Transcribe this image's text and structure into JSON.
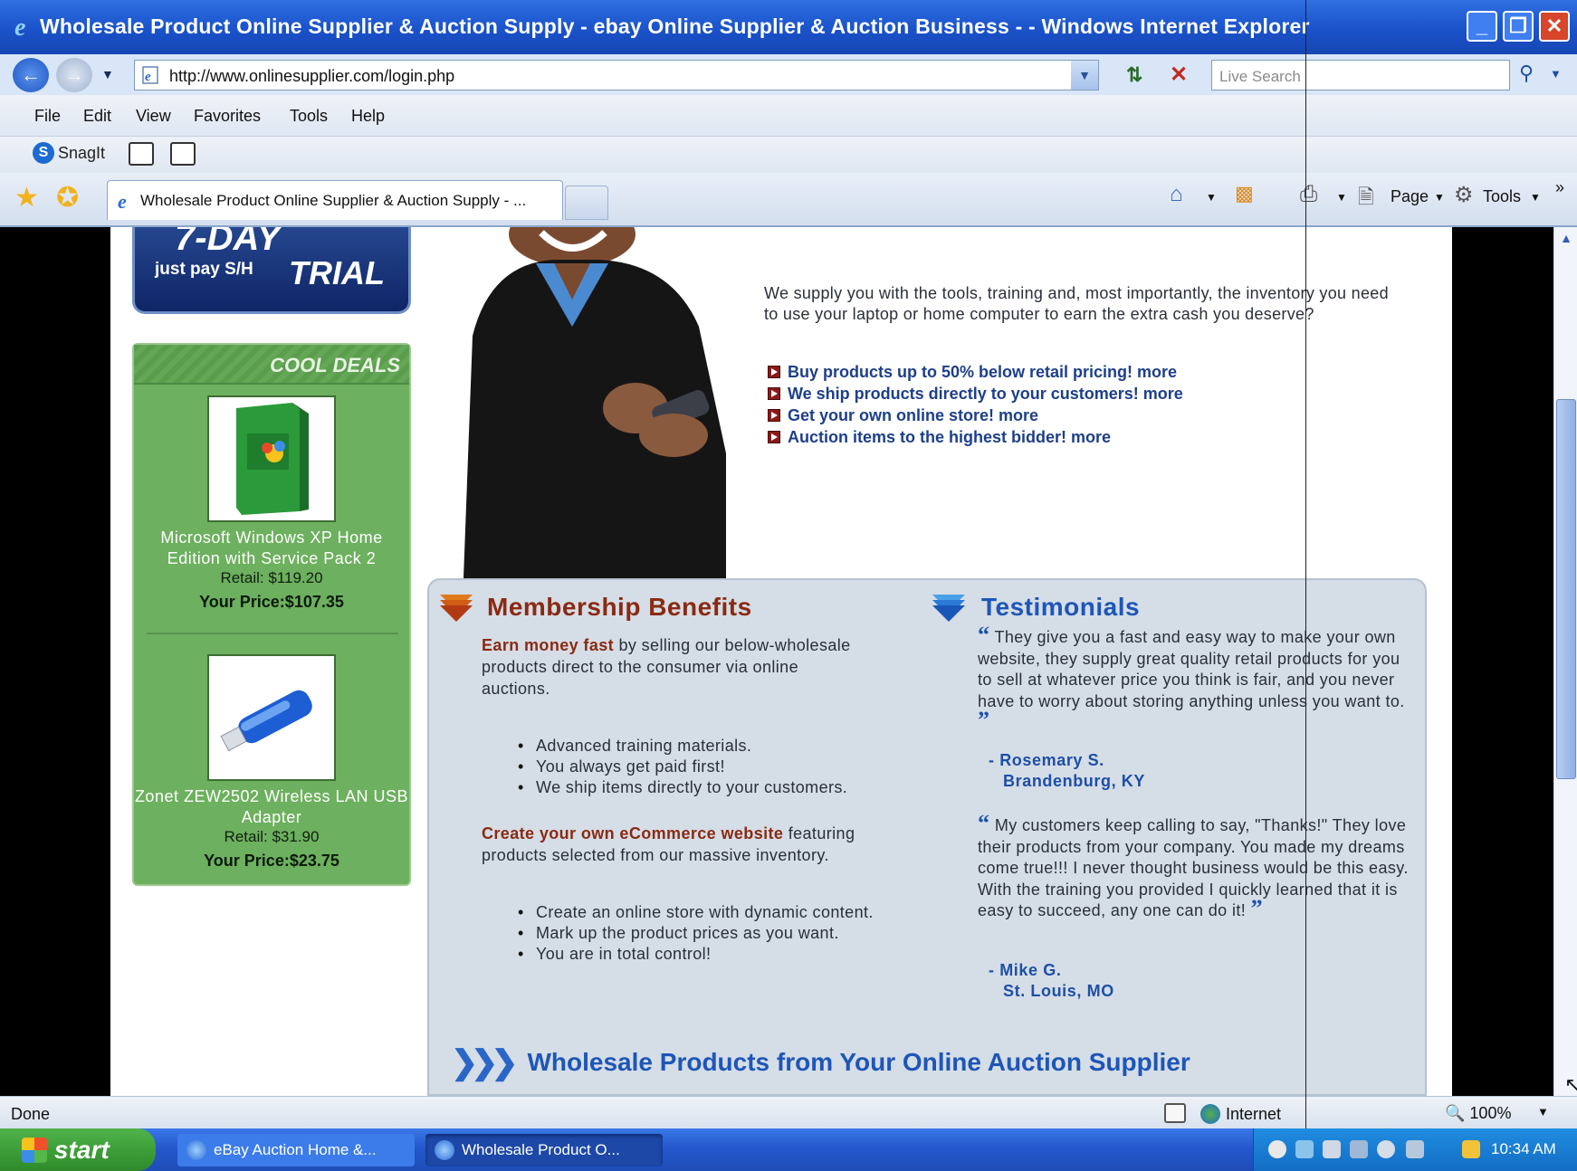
{
  "window": {
    "title": "Wholesale Product Online Supplier & Auction Supply - ebay Online Supplier & Auction Business -  - Windows Internet Explorer",
    "minimize_label": "_",
    "restore_label": "❐",
    "close_label": "✕"
  },
  "address_bar": {
    "url": "http://www.onlinesupplier.com/login.php",
    "search_placeholder": "Live Search"
  },
  "menu": {
    "items": [
      "File",
      "Edit",
      "View",
      "Favorites",
      "Tools",
      "Help"
    ]
  },
  "toolbar": {
    "snagit_label": "SnagIt"
  },
  "tabs": {
    "active_tab_label": "Wholesale Product Online Supplier & Auction Supply - ...",
    "page_label": "Page",
    "tools_label": "Tools"
  },
  "page": {
    "trial": {
      "small_text": "just pay S/H",
      "word": "TRIAL",
      "partial_top": "7-DAY"
    },
    "cool_deals": {
      "title": "COOL DEALS",
      "items": [
        {
          "name": "Microsoft Windows XP Home Edition with Service Pack 2",
          "retail": "Retail: $119.20",
          "price": "Your Price:$107.35"
        },
        {
          "name": "Zonet ZEW2502 Wireless LAN USB Adapter",
          "retail": "Retail: $31.90",
          "price": "Your Price:$23.75"
        }
      ]
    },
    "intro": "We supply you with the tools, training and, most importantly, the inventory you need to use your laptop or home computer to earn the extra cash you deserve?",
    "bullets": [
      "Buy products up to 50% below retail pricing! more",
      "We ship products directly to your customers! more",
      "Get your own online store! more",
      "Auction items to the highest bidder! more"
    ],
    "membership": {
      "title": "Membership Benefits",
      "para1_highlight": "Earn money fast",
      "para1_rest": " by selling our below-wholesale products direct to the consumer via online auctions.",
      "list1": [
        "Advanced training materials.",
        "You always get paid first!",
        "We ship items directly to your customers."
      ],
      "para2_highlight": "Create your own eCommerce website",
      "para2_rest": " featuring products selected from our massive inventory.",
      "list2": [
        "Create an online store with dynamic content.",
        "Mark up the product prices as you want.",
        "You are in total control!"
      ]
    },
    "testimonials": {
      "title": "Testimonials",
      "quotes": [
        {
          "text": "They give you a fast and easy way to make your own website, they supply great quality retail products for you to sell at whatever price you think is fair, and you never have to worry about storing anything unless you want to.",
          "author": "- Rosemary S.",
          "location": "Brandenburg, KY"
        },
        {
          "text": "My customers keep calling to say, \"Thanks!\" They love their products from your company. You made my dreams come true!!! I never thought business would be this easy. With the training you provided I quickly learned that it is easy to succeed, any one can do it!",
          "author": "- Mike G.",
          "location": "St. Louis, MO"
        }
      ]
    },
    "bottom_banner": "Wholesale Products from Your Online Auction Supplier"
  },
  "status_bar": {
    "status": "Done",
    "zone": "Internet",
    "zoom": "100%"
  },
  "taskbar": {
    "start_label": "start",
    "tasks": [
      "eBay Auction Home &...",
      "Wholesale Product O..."
    ],
    "clock": "10:34 AM"
  },
  "colors": {
    "title_bar": "#1a52c9",
    "deals_green": "#6db05f",
    "link_blue": "#1d3f8a",
    "accent_red": "#8a2a12",
    "panel_bg": "#d5dde6"
  }
}
